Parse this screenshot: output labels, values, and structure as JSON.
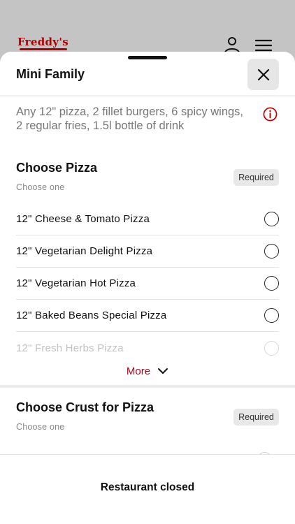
{
  "app": {
    "logo_text": "Freddy's"
  },
  "sheet": {
    "title": "Mini Family",
    "description": "Any 12\" pizza, 2 fillet burgers, 6 spicy wings, 2 regular fries, 1.5l bottle of drink"
  },
  "sections": [
    {
      "title": "Choose Pizza",
      "subtitle": "Choose one",
      "badge": "Required",
      "options": [
        {
          "label": "12\" Cheese & Tomato Pizza"
        },
        {
          "label": "12\" Vegetarian Delight Pizza"
        },
        {
          "label": "12\" Vegetarian Hot Pizza"
        },
        {
          "label": "12\" Baked Beans Special Pizza"
        },
        {
          "label": "12\" Fresh Herbs Pizza"
        }
      ],
      "more_label": "More"
    },
    {
      "title": "Choose Crust for Pizza",
      "subtitle": "Choose one",
      "badge": "Required"
    }
  ],
  "footer": {
    "status": "Restaurant closed"
  },
  "icons": {
    "user": "user-icon",
    "menu": "hamburger-menu-icon",
    "close": "close-icon",
    "info": "info-icon",
    "chevron": "chevron-down-icon"
  },
  "colors": {
    "brand": "#b00000",
    "more_link": "#b3001b",
    "overlay": "#c4c4c4"
  }
}
